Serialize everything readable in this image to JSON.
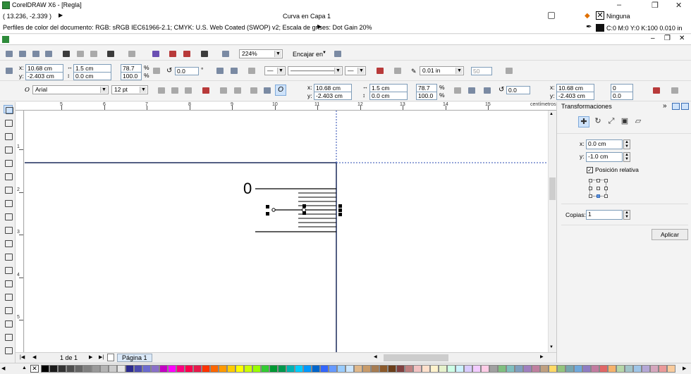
{
  "window": {
    "title": "CorelDRAW X6 - [Regla]",
    "controls": [
      "–",
      "❐",
      "✕"
    ]
  },
  "status": {
    "coords": "( 13.236, -2.339 )",
    "selection_info": "Curva en Capa 1",
    "fill_label": "Ninguna",
    "color_profiles": "Perfiles de color del documento: RGB: sRGB IEC61966-2.1; CMYK: U.S. Web Coated (SWOP) v2; Escala de grises: Dot Gain 20%",
    "outline_info": "C:0 M:0 Y:0 K:100  0.010 in"
  },
  "standard_toolbar": {
    "zoom": "224%",
    "snap_label": "Encajar en"
  },
  "property_bar": {
    "x": "10.68 cm",
    "y": "-2.403 cm",
    "width": "1.5 cm",
    "height": "0.0 cm",
    "scale_w": "78.7",
    "scale_h": "100.0",
    "pct": "%",
    "rotation": "0.0",
    "degree": "°",
    "outline_width": "0.01 in",
    "smooth": "50"
  },
  "text_bar": {
    "font": "Arial",
    "size": "12 pt",
    "x": "10.68 cm",
    "y": "-2.403 cm",
    "width": "1.5 cm",
    "height": "0.0 cm",
    "scale_w": "78.7",
    "scale_h": "100.0",
    "rotation": "0.0",
    "x2": "10.68 cm",
    "y2": "-2.403 cm",
    "a1": "0",
    "a2": "0.0"
  },
  "rulers": {
    "h_numbers": [
      "5",
      "6",
      "7",
      "8",
      "9",
      "10",
      "11",
      "12",
      "13",
      "14",
      "15",
      "16",
      "17"
    ],
    "unit": "centímetros",
    "v_numbers": [
      "1",
      "2",
      "3",
      "4",
      "5"
    ],
    "v_unit": "centímetros"
  },
  "canvas": {
    "label_zero": "0"
  },
  "docker": {
    "title": "Transformaciones",
    "x_label": "x:",
    "x_value": "0.0 cm",
    "y_label": "y:",
    "y_value": "-1.0 cm",
    "relative_label": "Posición relativa",
    "copies_label": "Copias:",
    "copies_value": "1",
    "apply_label": "Aplicar"
  },
  "pages": {
    "counter": "1 de 1",
    "tab": "Página 1"
  },
  "palette": [
    "#000000",
    "#1a1a1a",
    "#333333",
    "#4d4d4d",
    "#666666",
    "#808080",
    "#999999",
    "#b3b3b3",
    "#cccccc",
    "#e6e6e6",
    "#2b2b8f",
    "#4b4bb0",
    "#6b6bd0",
    "#8a6fc9",
    "#c400c4",
    "#ff00ff",
    "#ff0080",
    "#ff004d",
    "#e6194b",
    "#ff3300",
    "#ff6600",
    "#ff9900",
    "#ffcc00",
    "#ffff00",
    "#ccff00",
    "#99ff00",
    "#33cc33",
    "#009933",
    "#00994d",
    "#00b3b3",
    "#00ccff",
    "#0099ff",
    "#0066cc",
    "#3366ff",
    "#6699ff",
    "#99ccff",
    "#cce6ff",
    "#e0b88a",
    "#c89b6a",
    "#a67c52",
    "#8c5a2b",
    "#6b3e1a",
    "#804040",
    "#bf8080",
    "#f2c2c2",
    "#ffe0cc",
    "#fff2cc",
    "#e6f2cc",
    "#ccffe6",
    "#ccf2ff",
    "#d9ccff",
    "#f2ccff",
    "#ffcce6",
    "#a0a0a0",
    "#7fbf7f",
    "#7fbfbf",
    "#7f9fbf",
    "#9f7fbf",
    "#bf7f9f",
    "#bf9f7f",
    "#ffd966",
    "#93c47d",
    "#76a5af",
    "#6fa8dc",
    "#8e7cc3",
    "#c27ba0",
    "#e06666",
    "#f6b26b",
    "#b6d7a8",
    "#a2c4c9",
    "#9fc5e8",
    "#b4a7d6",
    "#d5a6bd",
    "#ea9999",
    "#f9cb9c",
    "#ffe599",
    "#d9ead3",
    "#d0e0e3",
    "#cfe2f3"
  ]
}
